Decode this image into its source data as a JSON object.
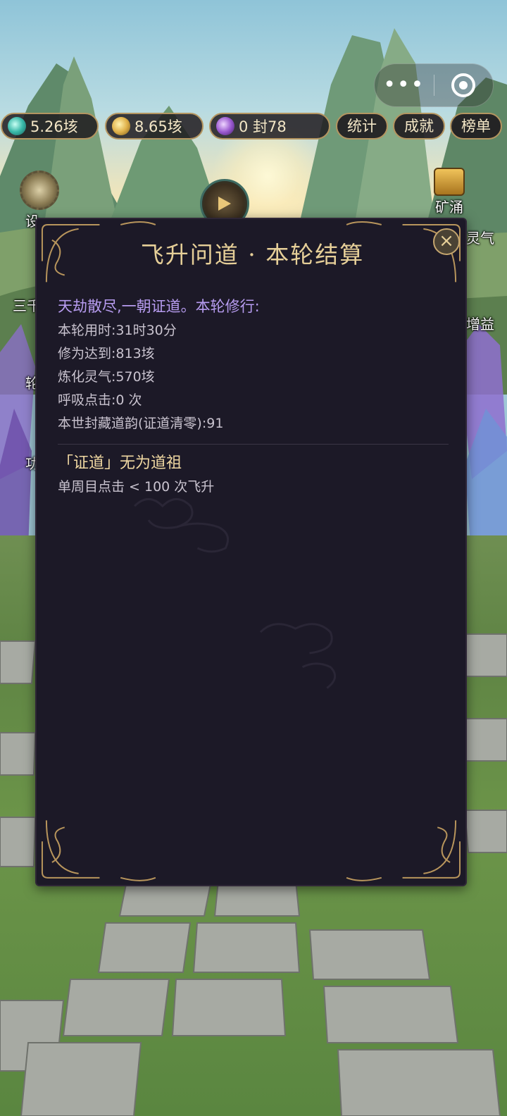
{
  "top_capsule": {
    "menu_icon": "more-dots-icon",
    "close_icon": "target-circle-icon"
  },
  "resources": [
    {
      "icon": "spirit-qi-icon",
      "value": "5.26垓"
    },
    {
      "icon": "gold-coin-icon",
      "value": "8.65垓"
    },
    {
      "icon": "violet-orb-icon",
      "value": "0 封78"
    }
  ],
  "top_buttons": {
    "stats": "统计",
    "achievements": "成就",
    "ranking": "榜单"
  },
  "side_labels": {
    "settings": "设",
    "mine": "矿涌",
    "spirit": "灵气",
    "sanqian": "三千",
    "boost": "增益",
    "wheel": "轮",
    "skill": "功"
  },
  "modal": {
    "title": "飞升问道 · 本轮结算",
    "close_icon": "close-x-icon",
    "summary_head": "天劫散尽,一朝证道。本轮修行:",
    "stats": [
      "本轮用时:31时30分",
      "修为达到:813垓",
      "炼化灵气:570垓",
      "呼吸点击:0 次",
      "本世封藏道韵(证道清零):91"
    ],
    "achievement": {
      "title": "「证道」无为道祖",
      "description": "单周目点击 < 100 次飞升"
    }
  },
  "colors": {
    "modal_bg": "#1c1927",
    "gold_frame": "#c4a56e",
    "title_gold": "#e6cf98",
    "summary_purple": "#b79cf0",
    "stat_text": "#c9c3cf"
  }
}
